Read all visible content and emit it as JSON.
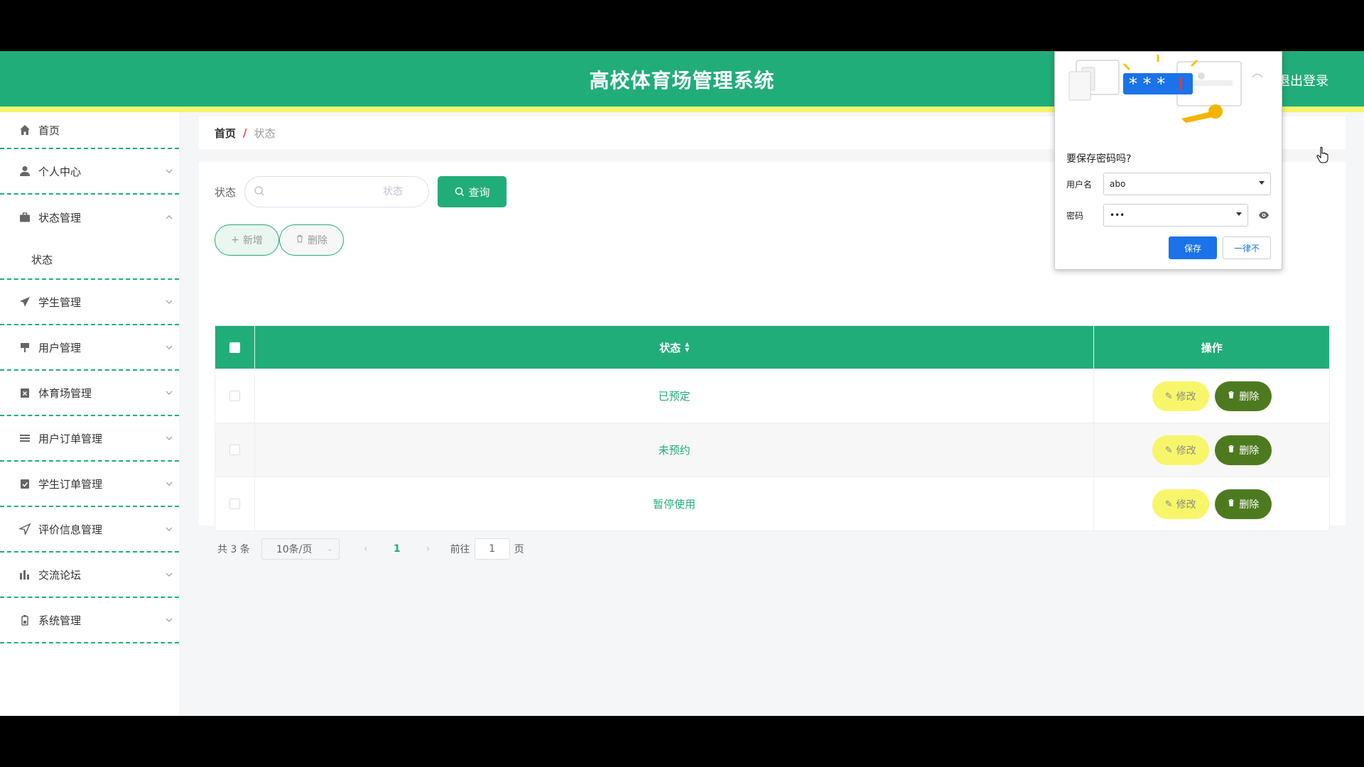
{
  "header": {
    "title": "高校体育场管理系统",
    "logout": "退出登录"
  },
  "sidebar": {
    "items": [
      {
        "label": "首页",
        "icon": "home-icon"
      },
      {
        "label": "个人中心",
        "icon": "user-icon"
      },
      {
        "label": "状态管理",
        "icon": "briefcase-icon"
      },
      {
        "label": "学生管理",
        "icon": "paper-plane-icon"
      },
      {
        "label": "用户管理",
        "icon": "sign-icon"
      },
      {
        "label": "体育场管理",
        "icon": "clipboard-x-icon"
      },
      {
        "label": "用户订单管理",
        "icon": "list-icon"
      },
      {
        "label": "学生订单管理",
        "icon": "clipboard-check-icon"
      },
      {
        "label": "评价信息管理",
        "icon": "location-arrow-icon"
      },
      {
        "label": "交流论坛",
        "icon": "bar-chart-icon"
      },
      {
        "label": "系统管理",
        "icon": "battery-icon"
      }
    ],
    "submenu": {
      "label": "状态"
    }
  },
  "breadcrumb": {
    "home": "首页",
    "separator": "/",
    "current": "状态"
  },
  "search": {
    "label": "状态",
    "placeholder": "状态",
    "query_button": "查询"
  },
  "actions": {
    "add": "新增",
    "delete": "删除"
  },
  "table": {
    "headers": {
      "status": "状态",
      "operation": "操作"
    },
    "rows": [
      {
        "status": "已预定"
      },
      {
        "status": "未预约"
      },
      {
        "status": "暂停使用"
      }
    ],
    "edit_label": "修改",
    "delete_label": "删除"
  },
  "pagination": {
    "total": "共 3 条",
    "page_size": "10条/页",
    "current_page": "1",
    "goto_label": "前往",
    "goto_value": "1",
    "page_suffix": "页"
  },
  "password_popup": {
    "title": "要保存密码吗?",
    "username_label": "用户名",
    "username_value": "abo",
    "password_label": "密码",
    "password_value": "•••",
    "save": "保存",
    "never": "一律不"
  },
  "colors": {
    "primary": "#21ad7a",
    "yellow": "#f5f56b",
    "edit_button": "#f7f66a",
    "delete_button": "#4e7a1f",
    "popup_blue": "#1a73e8"
  }
}
